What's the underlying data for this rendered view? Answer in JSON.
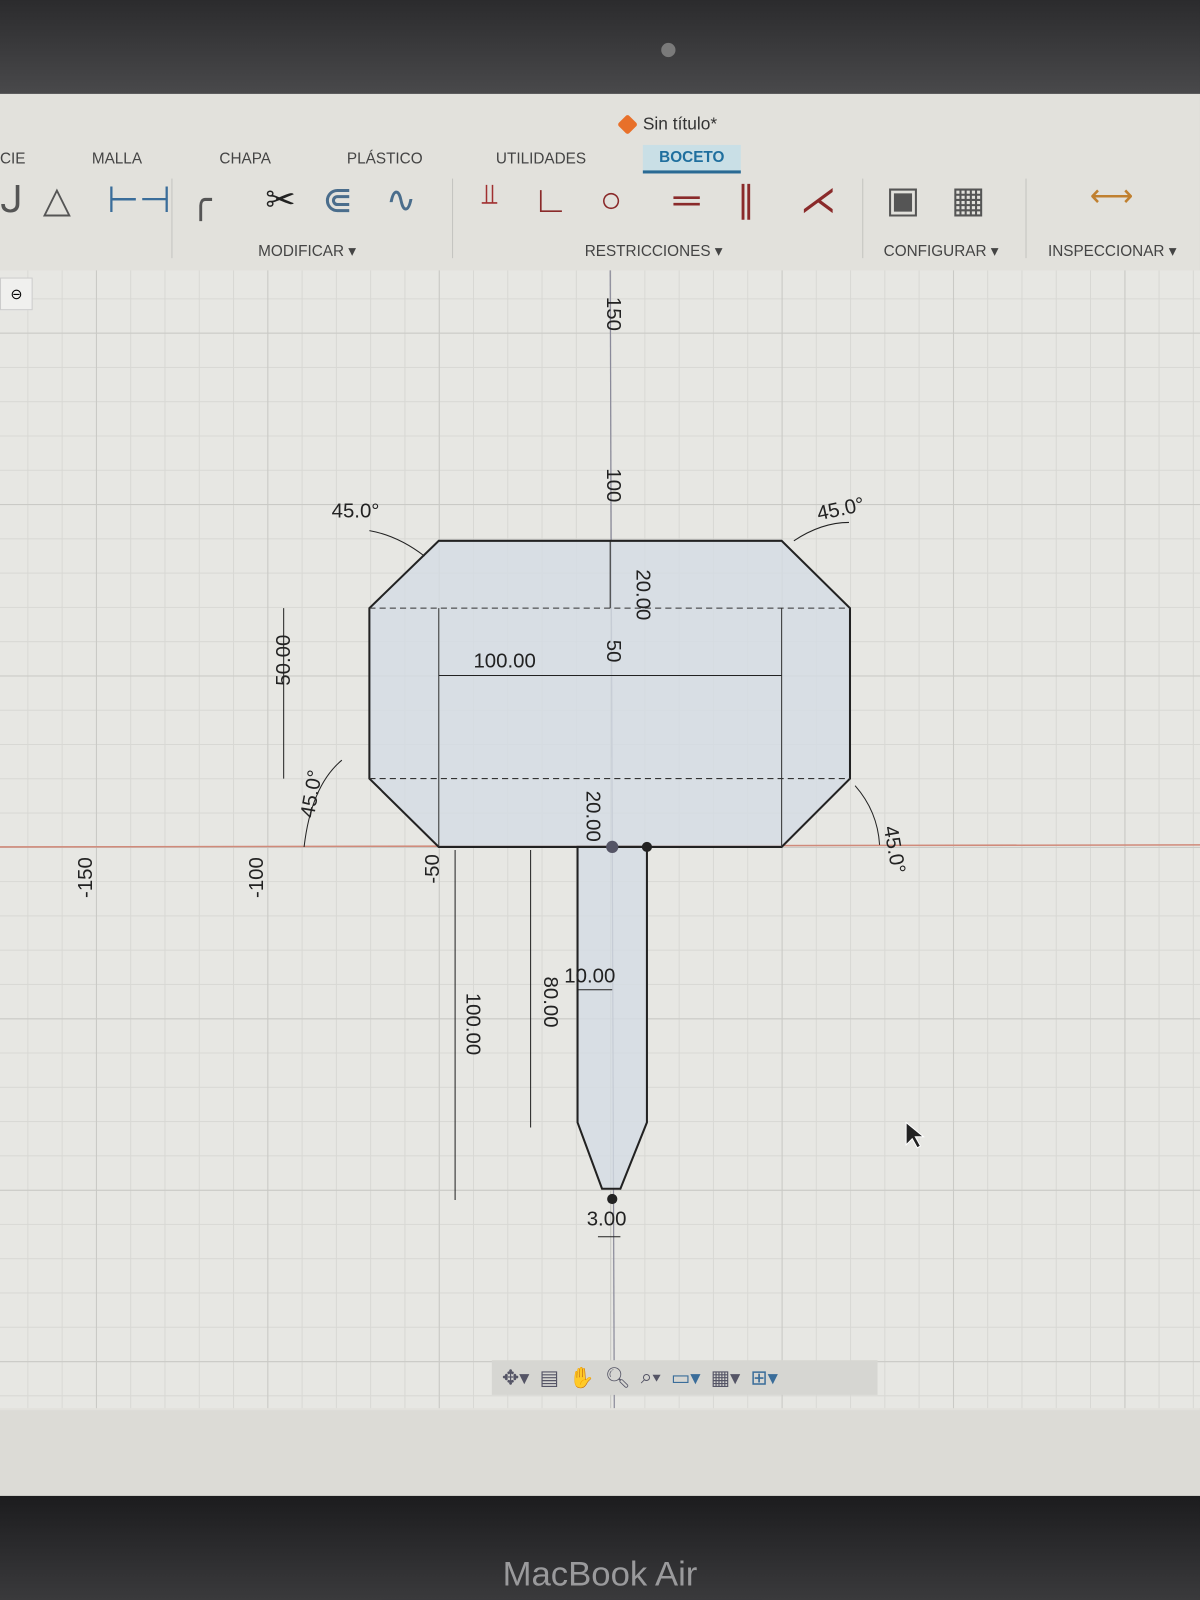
{
  "window": {
    "title": "Sin título*"
  },
  "tabs": [
    "CIE",
    "MALLA",
    "CHAPA",
    "PLÁSTICO",
    "UTILIDADES",
    "BOCETO"
  ],
  "toolbar_groups": [
    "MODIFICAR ▾",
    "RESTRICCIONES ▾",
    "CONFIGURAR ▾",
    "INSPECCIONAR ▾"
  ],
  "axis_labels": {
    "y": [
      "150",
      "100",
      "50"
    ],
    "x": [
      "-150",
      "-100",
      "-50"
    ]
  },
  "dimensions": {
    "angle_tl": "45.0°",
    "angle_tr": "45.0°",
    "angle_bl": "45.0°",
    "angle_br": "45.0°",
    "top_offset": "20.00",
    "head_width": "100.00",
    "side_height": "50.00",
    "bottom_offset": "20.00",
    "handle_width": "10.00",
    "handle_length": "80.00",
    "total_length": "100.00",
    "tip_width": "3.00"
  },
  "device": {
    "brand": "MacBook Air"
  },
  "colors": {
    "accent": "#1f6f9e",
    "sketch_fill": "#d5dce3",
    "axis_red": "#d08a7a"
  }
}
